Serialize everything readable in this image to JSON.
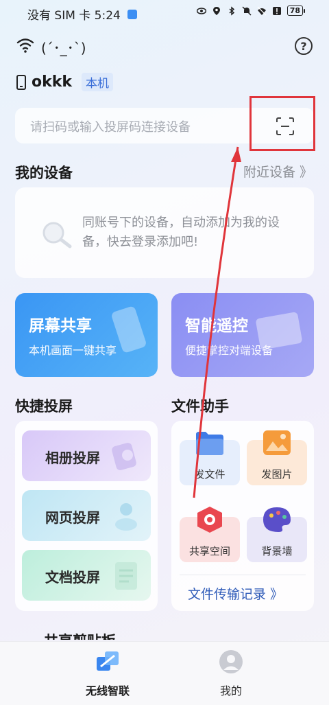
{
  "status_bar": {
    "left_text": "没有 SIM 卡 5:24",
    "battery": "78"
  },
  "header": {
    "kaomoji": "(´･_･`)",
    "device_name": "okkk",
    "local_badge": "本机"
  },
  "search": {
    "placeholder": "请扫码或输入投屏码连接设备"
  },
  "my_devices": {
    "title": "我的设备",
    "nearby_link": "附近设备 》",
    "empty_text": "同账号下的设备，自动添加为我的设备，快去登录添加吧!"
  },
  "features": {
    "screen_share": {
      "title": "屏幕共享",
      "subtitle": "本机画面一键共享"
    },
    "remote_control": {
      "title": "智能遥控",
      "subtitle": "便捷掌控对端设备"
    }
  },
  "quick_cast": {
    "title": "快捷投屏",
    "items": [
      "相册投屏",
      "网页投屏",
      "文档投屏"
    ]
  },
  "file_assistant": {
    "title": "文件助手",
    "items": [
      "发文件",
      "发图片",
      "共享空间",
      "背景墙"
    ],
    "record_link": "文件传输记录 》"
  },
  "partial_section_title": "共享剪贴板",
  "bottom_nav": {
    "items": [
      "无线智联",
      "我的"
    ]
  },
  "colors": {
    "accent_blue": "#3a96f4",
    "accent_purple": "#8a8ef3",
    "annotation_red": "#e0353b"
  }
}
